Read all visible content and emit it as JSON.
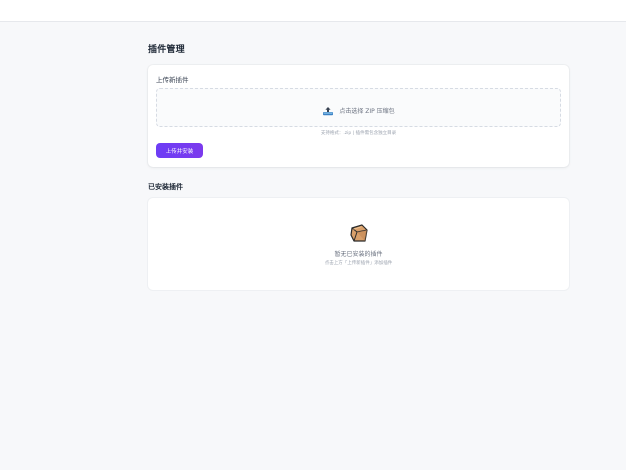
{
  "page": {
    "title": "插件管理"
  },
  "upload": {
    "label": "上传新插件",
    "dropzone_text": "点击选择 ZIP 压缩包",
    "dropzone_icon": "upload-tray-icon",
    "hint": "支持格式：.zip | 插件需包含独立目录",
    "button_label": "上传并安装"
  },
  "installed": {
    "title": "已安装插件",
    "empty_icon": "package-box-icon",
    "empty_title": "暂无已安装的插件",
    "empty_subtitle": "点击上方「上传新插件」添加插件"
  },
  "colors": {
    "accent": "#6d3df5",
    "background": "#f7f8fa",
    "card": "#ffffff"
  }
}
